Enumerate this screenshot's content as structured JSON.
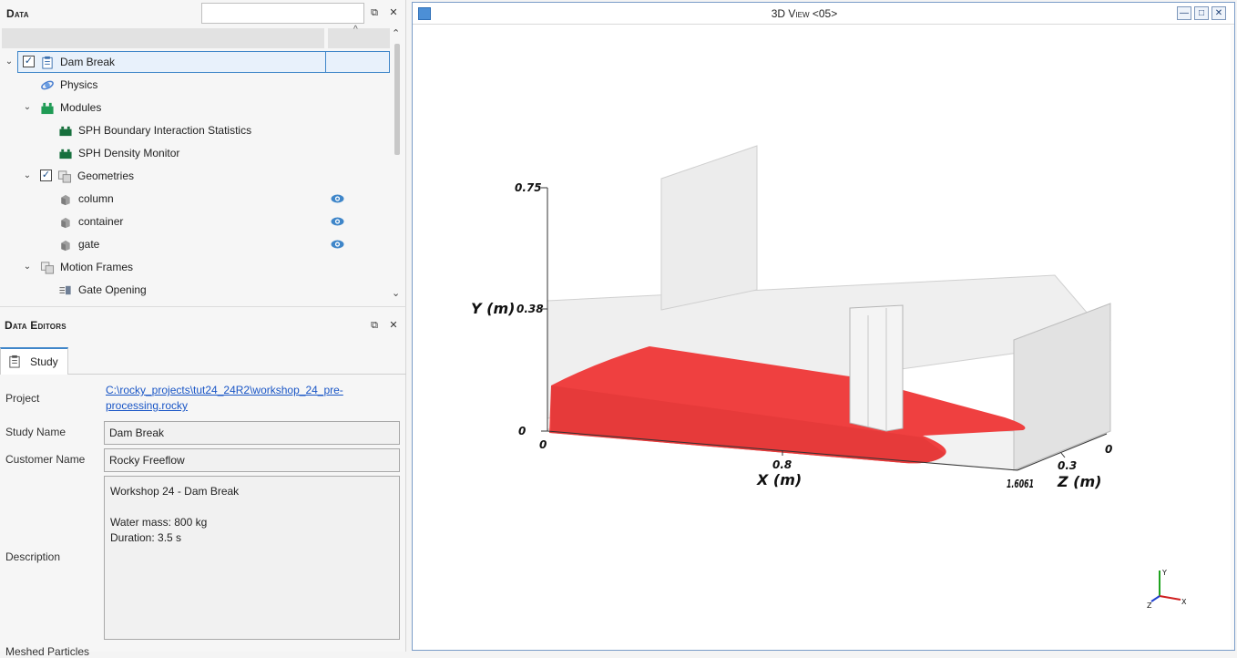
{
  "data_panel": {
    "title": "Data",
    "search_value": "",
    "float_icon": "float-icon",
    "close_icon": "close-icon",
    "sort_glyph": "^",
    "tree": [
      {
        "label": "Dam Break",
        "icon": "clipboard-icon",
        "checked": true,
        "expanded": true
      },
      {
        "label": "Physics",
        "icon": "physics-icon"
      },
      {
        "label": "Modules",
        "icon": "modules-icon",
        "expanded": true
      },
      {
        "label": "SPH Boundary Interaction Statistics",
        "icon": "module-block-icon"
      },
      {
        "label": "SPH Density Monitor",
        "icon": "module-block-icon"
      },
      {
        "label": "Geometries",
        "icon": "geometries-icon",
        "checked": true,
        "expanded": true
      },
      {
        "label": "column",
        "icon": "geometry-icon",
        "visible": true
      },
      {
        "label": "container",
        "icon": "geometry-icon",
        "visible": true
      },
      {
        "label": "gate",
        "icon": "geometry-icon",
        "visible": true
      },
      {
        "label": "Motion Frames",
        "icon": "motion-frames-icon",
        "expanded": true
      },
      {
        "label": "Gate Opening",
        "icon": "motion-frame-icon"
      }
    ]
  },
  "editors_panel": {
    "title": "Data Editors",
    "tab_label": "Study",
    "fields": {
      "project_label": "Project",
      "project_path": "C:\\rocky_projects\\tut24_24R2\\workshop_24_pre-processing.rocky",
      "study_name_label": "Study Name",
      "study_name_value": "Dam Break",
      "customer_name_label": "Customer Name",
      "customer_name_value": "Rocky Freeflow",
      "description_label": "Description",
      "description_lines": [
        "Workshop 24 - Dam Break",
        "",
        "Water mass: 800 kg",
        "Duration: 3.5 s"
      ],
      "cut_label": "Meshed Particles"
    }
  },
  "view": {
    "title": "3D View <05>",
    "axes": {
      "y_label": "Y (m)",
      "x_label": "X (m)",
      "z_label": "Z (m)",
      "y_ticks": [
        "0.75",
        "0.38",
        "0"
      ],
      "x_ticks": [
        "0",
        "0.8",
        "1.6061"
      ],
      "z_ticks": [
        "0",
        "0.3"
      ]
    },
    "triad": {
      "x": "X",
      "y": "Y",
      "z": "Z"
    },
    "colors": {
      "fluid": "#ef4040",
      "geometry": "#d9d9d9",
      "accent": "#3f86c9"
    }
  }
}
